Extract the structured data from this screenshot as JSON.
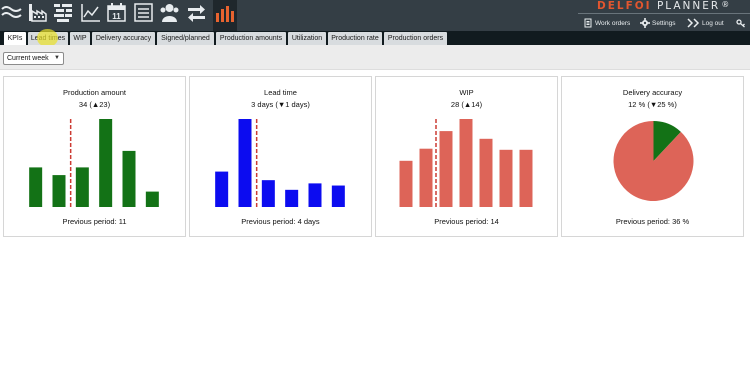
{
  "toolbar": {
    "icons": [
      "wave-icon",
      "factory-icon",
      "gantt-icon",
      "line-chart-icon",
      "calendar-icon",
      "list-icon",
      "users-icon",
      "exchange-icon",
      "bar-chart-icon"
    ],
    "calendar_number": "11"
  },
  "logo": {
    "brand": "DELFOI",
    "product": "PLANNER",
    "registered": "®"
  },
  "header_links": {
    "work_orders": "Work orders",
    "settings": "Settings",
    "logout": "Log out"
  },
  "tabs": [
    {
      "label": "KPIs",
      "active": true
    },
    {
      "label": "Lead times",
      "active": false
    },
    {
      "label": "WIP",
      "active": false
    },
    {
      "label": "Delivery accuracy",
      "active": false
    },
    {
      "label": "Signed/planned",
      "active": false
    },
    {
      "label": "Production amounts",
      "active": false
    },
    {
      "label": "Utilization",
      "active": false
    },
    {
      "label": "Production rate",
      "active": false
    },
    {
      "label": "Production orders",
      "active": false
    }
  ],
  "filter": {
    "period": "Current week"
  },
  "cards": [
    {
      "title": "Production amount",
      "value": "34 (▲23)",
      "previous": "Previous period: 11"
    },
    {
      "title": "Lead time",
      "value": "3 days (▼1 days)",
      "previous": "Previous period: 4 days"
    },
    {
      "title": "WIP",
      "value": "28 (▲14)",
      "previous": "Previous period: 14"
    },
    {
      "title": "Delivery accuracy",
      "value": "12 % (▼25 %)",
      "previous": "Previous period: 36 %"
    }
  ],
  "chart_data": [
    {
      "type": "bar",
      "values": [
        36,
        29,
        36,
        80,
        51,
        14
      ],
      "ylim": [
        0,
        80
      ],
      "marker_after_index": 1,
      "color": "#137216"
    },
    {
      "type": "bar",
      "values": [
        33,
        82,
        25,
        16,
        22,
        20
      ],
      "ylim": [
        0,
        82
      ],
      "marker_after_index": 1,
      "color": "#0c0cf0"
    },
    {
      "type": "bar",
      "values": [
        42,
        53,
        69,
        80,
        62,
        52,
        52
      ],
      "ylim": [
        0,
        80
      ],
      "marker_after_index": 1,
      "color": "#dd6458"
    },
    {
      "type": "pie",
      "slices": [
        {
          "value": 12,
          "color": "#137216"
        },
        {
          "value": 88,
          "color": "#dd6458"
        }
      ]
    }
  ],
  "colors": {
    "topbar": "#343e45",
    "tabbar": "#111b1f",
    "marker": "#cc3b33"
  }
}
